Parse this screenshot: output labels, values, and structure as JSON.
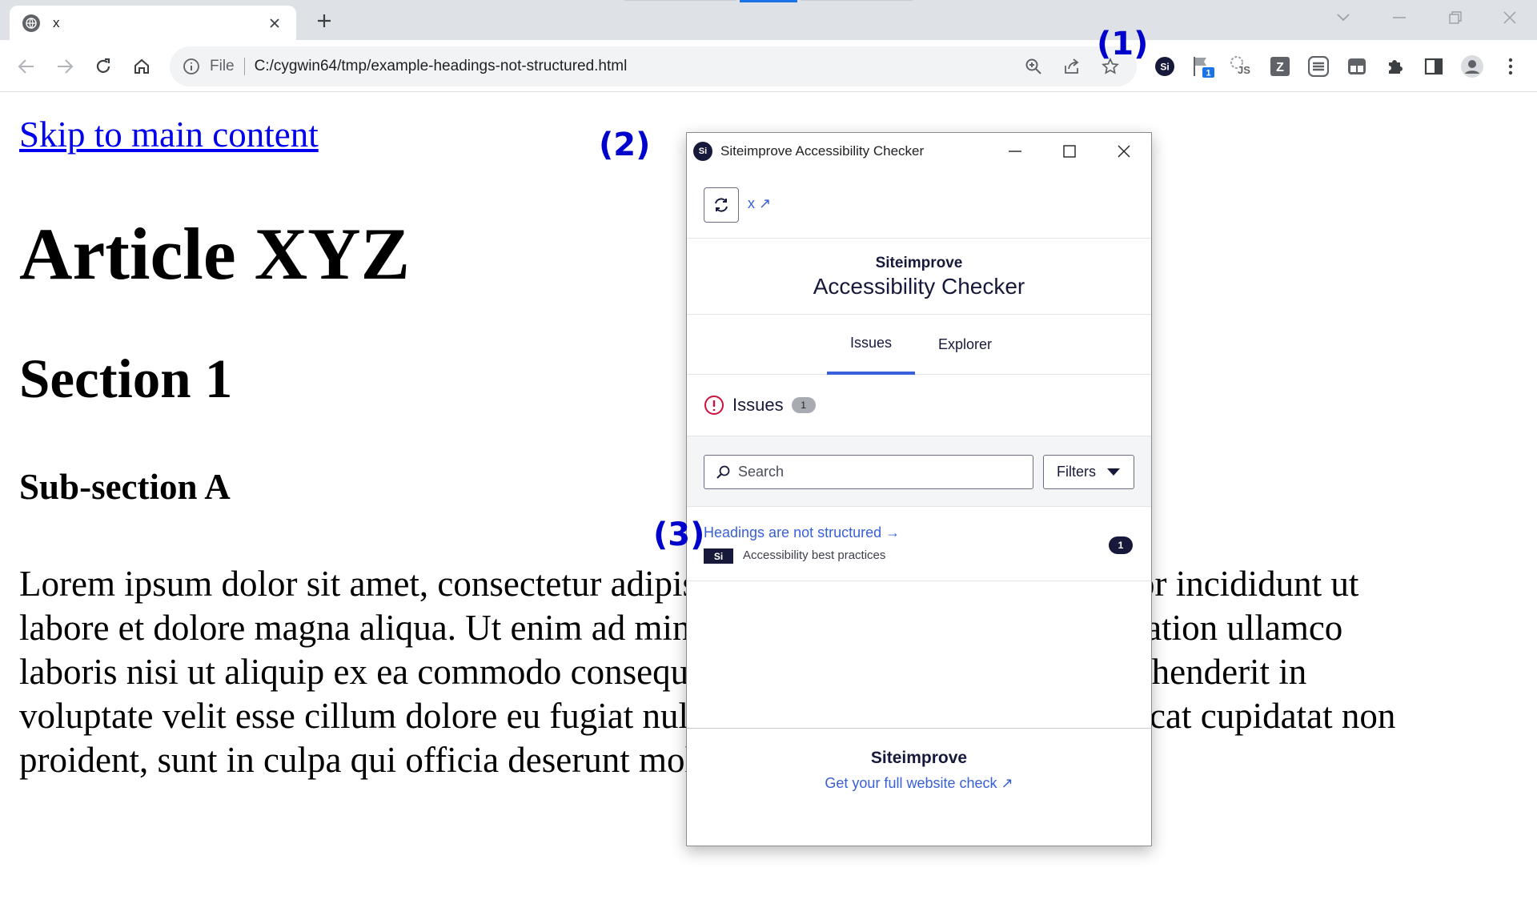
{
  "browser": {
    "tab": {
      "title": "x"
    },
    "address": {
      "scheme": "File",
      "url": "C:/cygwin64/tmp/example-headings-not-structured.html"
    },
    "extensions": [
      {
        "name": "siteimprove-icon"
      },
      {
        "name": "flag-icon",
        "badge": "1"
      },
      {
        "name": "js-icon"
      },
      {
        "name": "z-icon"
      },
      {
        "name": "s-stack-icon"
      },
      {
        "name": "panel-icon"
      },
      {
        "name": "puzzle-icon"
      },
      {
        "name": "sidepanel-icon"
      },
      {
        "name": "profile-icon"
      },
      {
        "name": "menu-icon"
      }
    ]
  },
  "page": {
    "skip_link": "Skip to main content",
    "h1": "Article XYZ",
    "h2": "Section 1",
    "h3": "Sub-section A",
    "paragraph_lines": [
      "Lorem ipsum dolor sit amet, consectetur adipiscing elit, sed do eiusmod tempor incididunt ut",
      "labore et dolore magna aliqua. Ut enim ad minim veniam, quis nostrud exercitation ullamco",
      "laboris nisi ut aliquip ex ea commodo consequat. Duis aute irure dolor in reprehenderit in",
      "voluptate velit esse cillum dolore eu fugiat nulla pariatur. Excepteur sint occaecat cupidatat non",
      "proident, sunt in culpa qui officia deserunt mollit anim id est laborum."
    ]
  },
  "annotations": {
    "a1": "(1)",
    "a2": "(2)",
    "a3": "(3)"
  },
  "popup": {
    "window_title": "Siteimprove Accessibility Checker",
    "logo_text": "Si",
    "page_link": "x ↗",
    "brand": "Siteimprove",
    "product": "Accessibility Checker",
    "tabs": [
      "Issues",
      "Explorer"
    ],
    "issues_label": "Issues",
    "issues_count": "1",
    "search_placeholder": "Search",
    "filters_label": "Filters",
    "issue": {
      "title": "Headings are not structured →",
      "badge": "Si",
      "category": "Accessibility best practices",
      "count": "1"
    },
    "footer_brand": "Siteimprove",
    "footer_link": "Get your full website check ↗"
  },
  "colors": {
    "accent": "#3860d8",
    "navy": "#17193b",
    "alert": "#d0103a",
    "annotation": "#0000cc"
  }
}
